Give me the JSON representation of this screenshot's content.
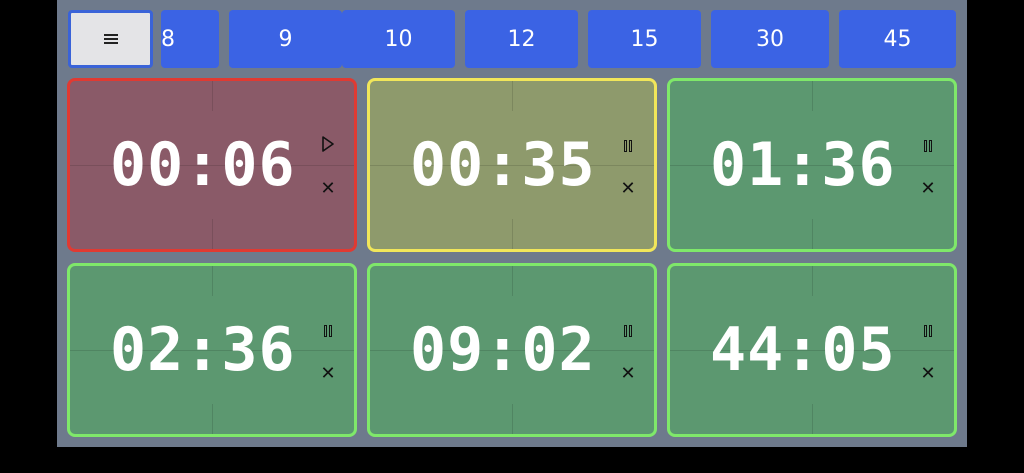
{
  "toolbar": {
    "menu_icon": "hamburger-menu-icon",
    "presets": [
      "8",
      "9",
      "10",
      "12",
      "15",
      "30",
      "45"
    ]
  },
  "timers": [
    {
      "time": "00:06",
      "state": "paused",
      "toggle_icon": "play-icon",
      "close_icon": "close-icon",
      "border": "#e03a32",
      "bg": "#8a5a68"
    },
    {
      "time": "00:35",
      "state": "running",
      "toggle_icon": "pause-icon",
      "close_icon": "close-icon",
      "border": "#f1e65a",
      "bg": "#8e9a6c"
    },
    {
      "time": "01:36",
      "state": "running",
      "toggle_icon": "pause-icon",
      "close_icon": "close-icon",
      "border": "#7fe86a",
      "bg": "#5c9870"
    },
    {
      "time": "02:36",
      "state": "running",
      "toggle_icon": "pause-icon",
      "close_icon": "close-icon",
      "border": "#7fe86a",
      "bg": "#5c9870"
    },
    {
      "time": "09:02",
      "state": "running",
      "toggle_icon": "pause-icon",
      "close_icon": "close-icon",
      "border": "#7fe86a",
      "bg": "#5c9870"
    },
    {
      "time": "44:05",
      "state": "running",
      "toggle_icon": "pause-icon",
      "close_icon": "close-icon",
      "border": "#7fe86a",
      "bg": "#5c9870"
    }
  ],
  "close_glyph": "✕"
}
